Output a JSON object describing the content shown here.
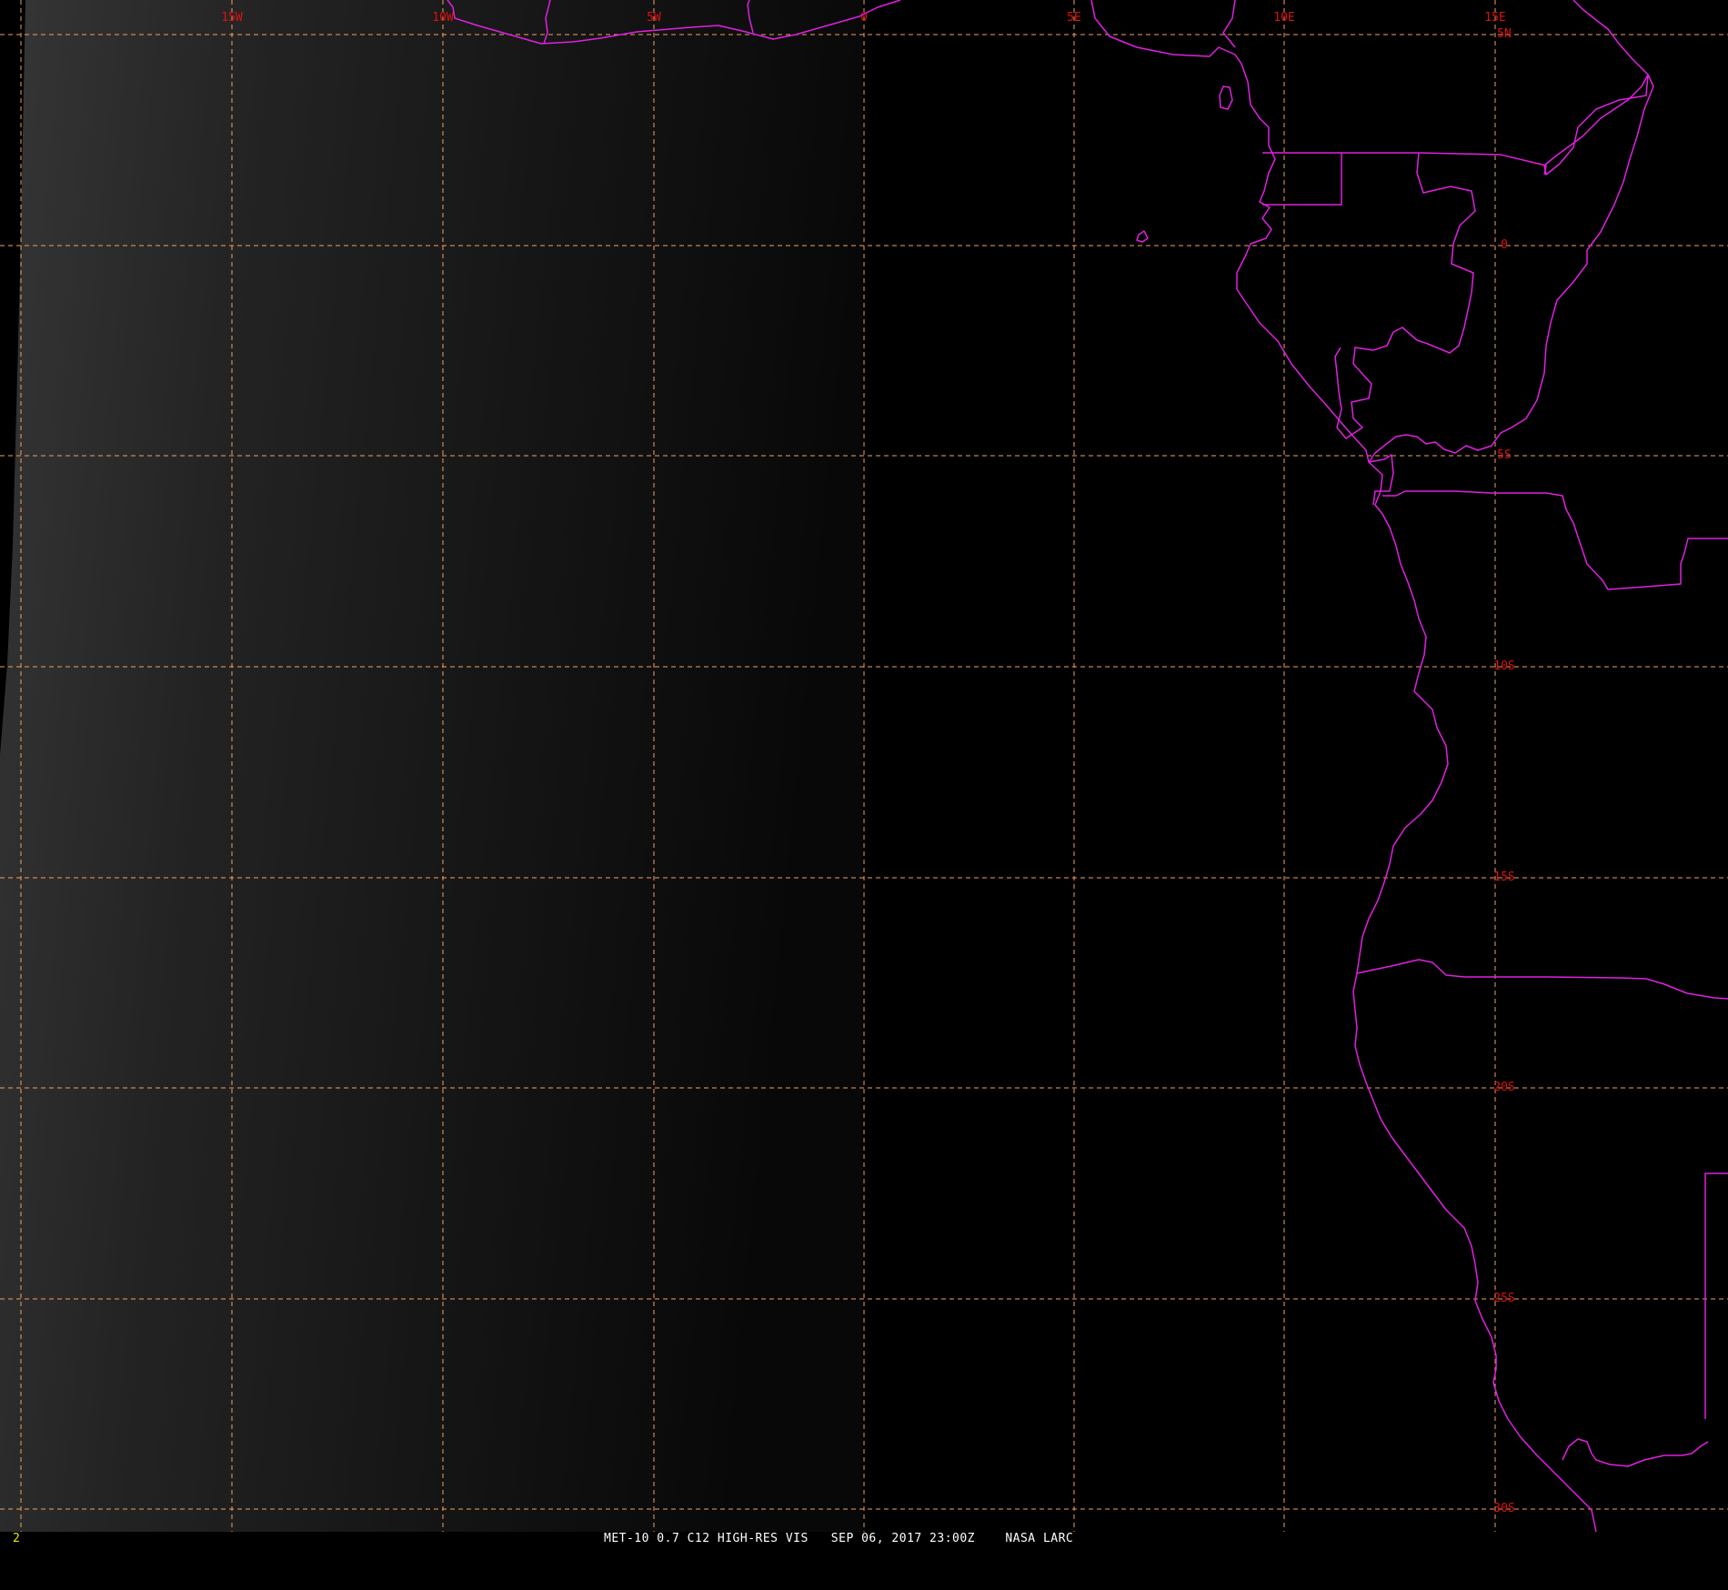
{
  "map": {
    "longitude_labels": [
      "15W",
      "10W",
      "5W",
      "0",
      "5E",
      "10E",
      "15E"
    ],
    "latitude_labels": [
      "5N",
      "0",
      "5S",
      "10S",
      "15S",
      "20S",
      "25S",
      "30S"
    ],
    "colors": {
      "gridline": "#f0a060",
      "grid_label": "#dd1111",
      "boundary": "#e020e0",
      "background": "#000000"
    }
  },
  "status": {
    "frame_number": "2",
    "text": "MET-10 0.7 C12 HIGH-RES VIS   SEP 06, 2017 23:00Z    NASA LARC"
  }
}
